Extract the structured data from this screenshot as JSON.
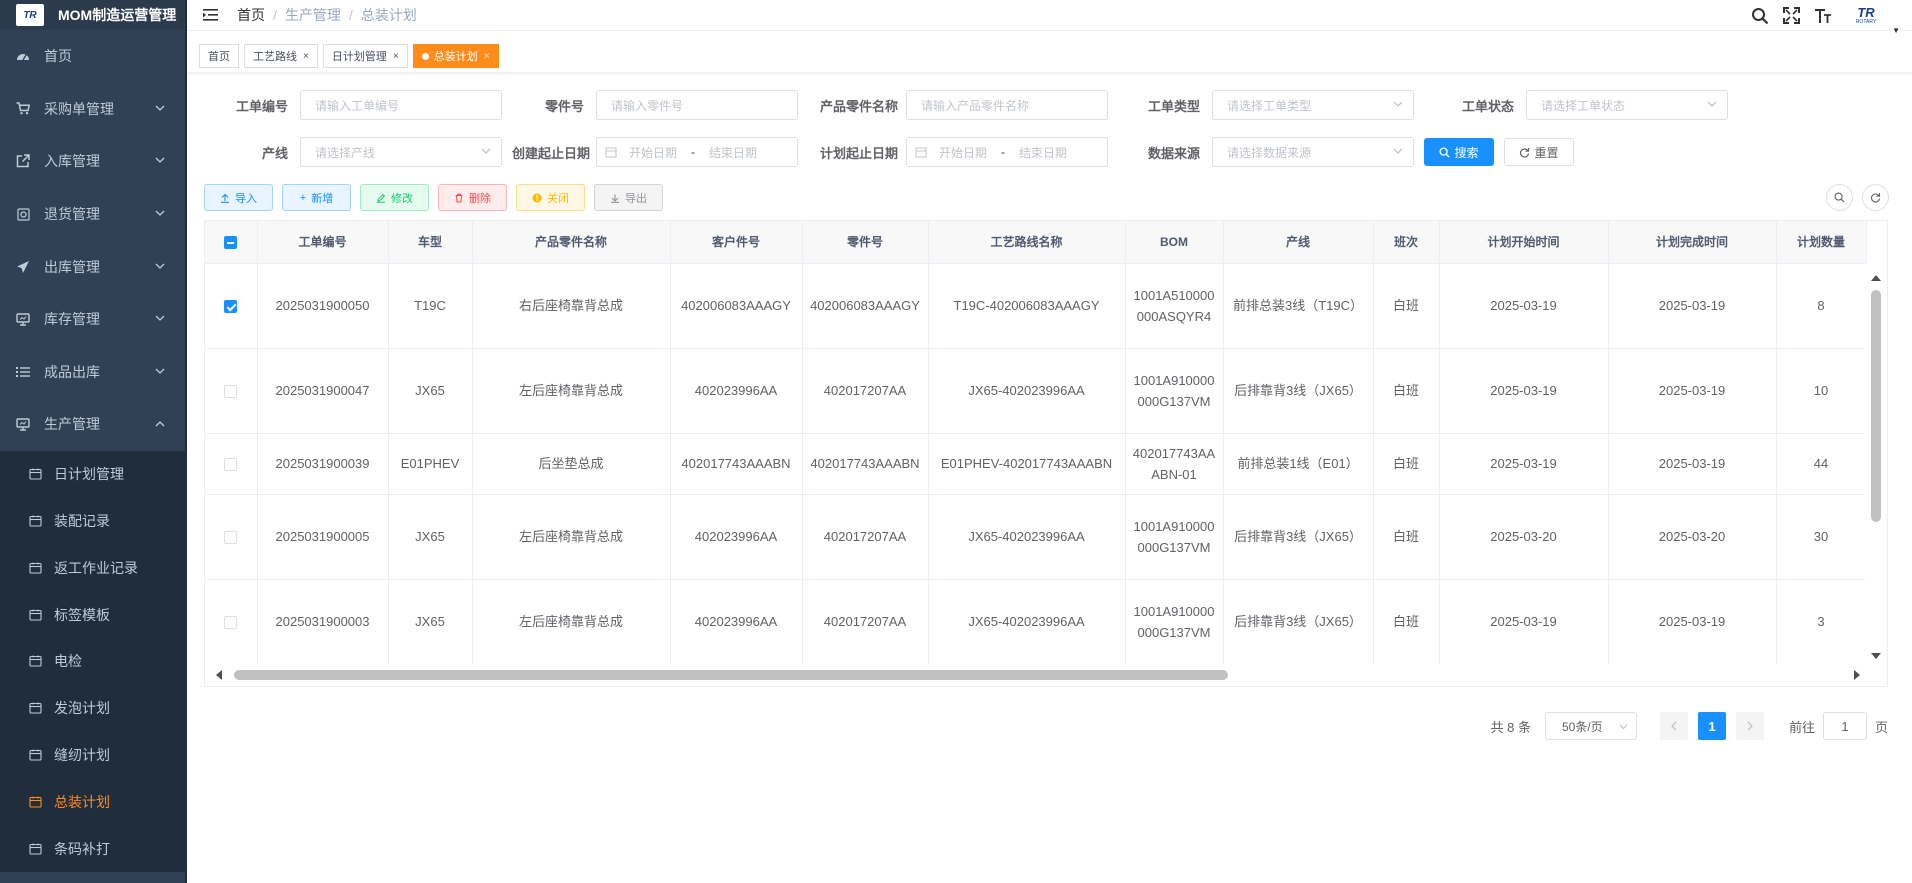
{
  "app": {
    "title": "MOM制造运营管理",
    "logo_text": "TR"
  },
  "sidebar": {
    "items": [
      {
        "label": "首页",
        "icon": "dashboard-icon"
      },
      {
        "label": "采购单管理",
        "icon": "cart-icon"
      },
      {
        "label": "入库管理",
        "icon": "external-link-icon"
      },
      {
        "label": "退货管理",
        "icon": "return-icon"
      },
      {
        "label": "出库管理",
        "icon": "paper-plane-icon"
      },
      {
        "label": "库存管理",
        "icon": "monitor-icon"
      },
      {
        "label": "成品出库",
        "icon": "list-icon"
      },
      {
        "label": "生产管理",
        "icon": "monitor-icon"
      }
    ],
    "subitems": [
      {
        "label": "日计划管理"
      },
      {
        "label": "装配记录"
      },
      {
        "label": "返工作业记录"
      },
      {
        "label": "标签模板"
      },
      {
        "label": "电检"
      },
      {
        "label": "发泡计划"
      },
      {
        "label": "缝纫计划"
      },
      {
        "label": "总装计划"
      },
      {
        "label": "条码补打"
      }
    ]
  },
  "breadcrumb": [
    "首页",
    "生产管理",
    "总装计划"
  ],
  "header": {
    "avatar_text": "TR",
    "avatar_sub": "ROTARY"
  },
  "tags": [
    {
      "label": "首页"
    },
    {
      "label": "工艺路线"
    },
    {
      "label": "日计划管理"
    },
    {
      "label": "总装计划"
    }
  ],
  "form": {
    "order_no": {
      "label": "工单编号",
      "placeholder": "请输入工单编号"
    },
    "part_no": {
      "label": "零件号",
      "placeholder": "请输入零件号"
    },
    "part_name": {
      "label": "产品零件名称",
      "placeholder": "请输入产品零件名称"
    },
    "order_type": {
      "label": "工单类型",
      "placeholder": "请选择工单类型"
    },
    "order_status": {
      "label": "工单状态",
      "placeholder": "请选择工单状态"
    },
    "line": {
      "label": "产线",
      "placeholder": "请选择产线"
    },
    "create_date": {
      "label": "创建起止日期",
      "start": "开始日期",
      "end": "结束日期"
    },
    "plan_date": {
      "label": "计划起止日期",
      "start": "开始日期",
      "end": "结束日期"
    },
    "source": {
      "label": "数据来源",
      "placeholder": "请选择数据来源"
    },
    "search_label": "搜索",
    "reset_label": "重置"
  },
  "toolbar": {
    "import": "导入",
    "add": "新增",
    "edit": "修改",
    "delete": "删除",
    "close": "关闭",
    "export": "导出"
  },
  "table": {
    "columns": [
      "工单编号",
      "车型",
      "产品零件名称",
      "客户件号",
      "零件号",
      "工艺路线名称",
      "BOM",
      "产线",
      "班次",
      "计划开始时间",
      "计划完成时间",
      "计划数量"
    ],
    "rows": [
      {
        "checked": true,
        "cells": [
          "2025031900050",
          "T19C",
          "右后座椅靠背总成",
          "402006083AAAGY",
          "402006083AAAGY",
          "T19C-402006083AAAGY",
          "1001A510000000ASQYR4",
          "前排总装3线（T19C）",
          "白班",
          "2025-03-19",
          "2025-03-19",
          "8"
        ]
      },
      {
        "checked": false,
        "cells": [
          "2025031900047",
          "JX65",
          "左后座椅靠背总成",
          "402023996AA",
          "402017207AA",
          "JX65-402023996AA",
          "1001A910000000G137VM",
          "后排靠背3线（JX65）",
          "白班",
          "2025-03-19",
          "2025-03-19",
          "10"
        ]
      },
      {
        "checked": false,
        "cells": [
          "2025031900039",
          "E01PHEV",
          "后坐垫总成",
          "402017743AAABN",
          "402017743AAABN",
          "E01PHEV-402017743AAABN",
          "402017743AAABN-01",
          "前排总装1线（E01）",
          "白班",
          "2025-03-19",
          "2025-03-19",
          "44"
        ]
      },
      {
        "checked": false,
        "cells": [
          "2025031900005",
          "JX65",
          "左后座椅靠背总成",
          "402023996AA",
          "402017207AA",
          "JX65-402023996AA",
          "1001A910000000G137VM",
          "后排靠背3线（JX65）",
          "白班",
          "2025-03-20",
          "2025-03-20",
          "30"
        ]
      },
      {
        "checked": false,
        "cells": [
          "2025031900003",
          "JX65",
          "左后座椅靠背总成",
          "402023996AA",
          "402017207AA",
          "JX65-402023996AA",
          "1001A910000000G137VM",
          "后排靠背3线（JX65）",
          "白班",
          "2025-03-19",
          "2025-03-19",
          "3"
        ]
      }
    ]
  },
  "pagination": {
    "total": "共 8 条",
    "page_size": "50条/页",
    "current": "1",
    "goto_prefix": "前往",
    "goto_value": "1",
    "goto_suffix": "页"
  },
  "colors": {
    "sidebar_bg": "#304156",
    "accent": "#ff8c1a",
    "primary": "#1890ff"
  }
}
